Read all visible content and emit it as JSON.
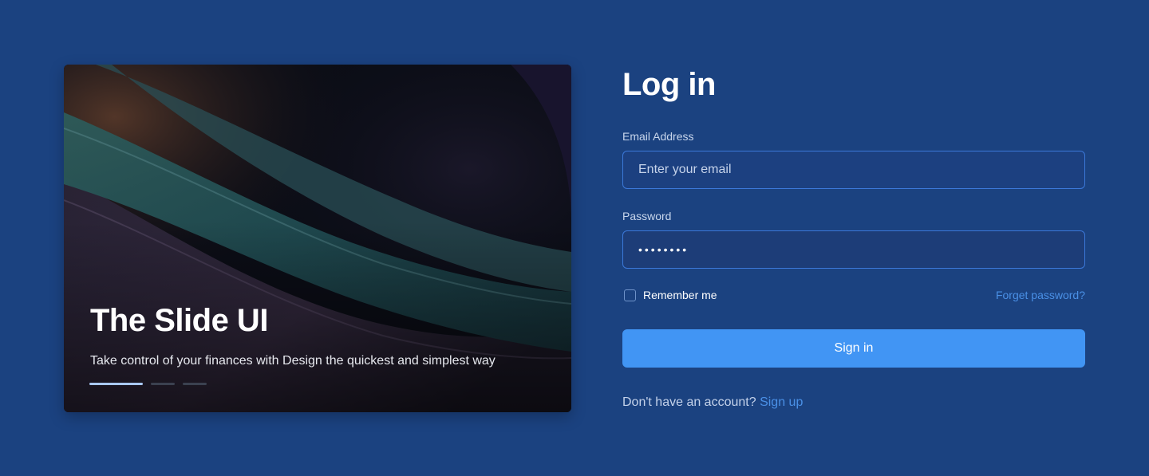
{
  "slide": {
    "title": "The Slide UI",
    "subtitle": "Take control of your finances with Design the quickest and simplest way",
    "indicator": {
      "count": 3,
      "active_index": 0
    }
  },
  "form": {
    "title": "Log in",
    "email": {
      "label": "Email Address",
      "placeholder": "Enter your email",
      "value": ""
    },
    "password": {
      "label": "Password",
      "value": "sampassw"
    },
    "remember_label": "Remember me",
    "remember_checked": false,
    "forgot_label": "Forget password?",
    "submit_label": "Sign in",
    "signup_prompt": "Don't have an account?",
    "signup_link": "Sign up"
  },
  "colors": {
    "background": "#1b4280",
    "primary_button": "#4195f4",
    "link": "#4a90e6",
    "input_border": "#3b78d8"
  }
}
